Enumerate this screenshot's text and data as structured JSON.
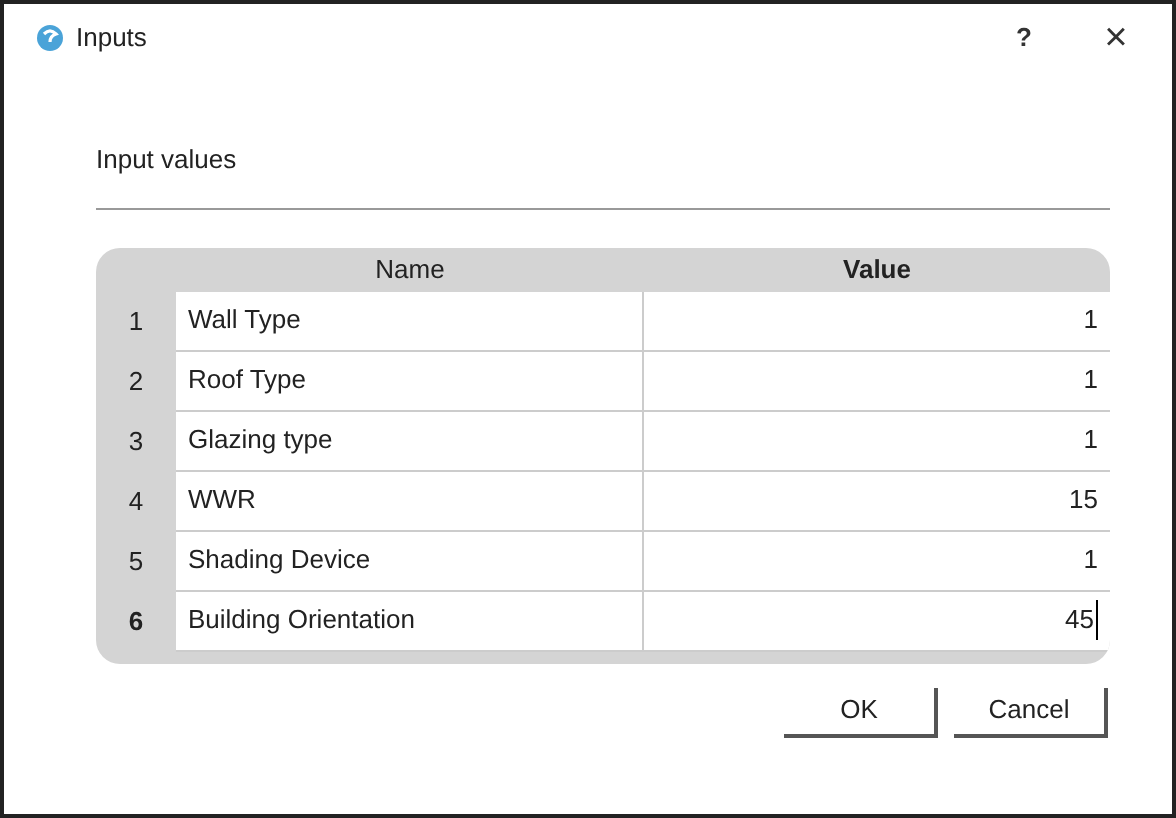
{
  "window": {
    "title": "Inputs",
    "help": "?",
    "close": "×"
  },
  "section_label": "Input values",
  "table": {
    "columns": [
      "Name",
      "Value"
    ],
    "rows": [
      {
        "number": "1",
        "name": "Wall Type",
        "value": "1",
        "current": false
      },
      {
        "number": "2",
        "name": "Roof Type",
        "value": "1",
        "current": false
      },
      {
        "number": "3",
        "name": "Glazing type",
        "value": "1",
        "current": false
      },
      {
        "number": "4",
        "name": "WWR",
        "value": "15",
        "current": false
      },
      {
        "number": "5",
        "name": "Shading Device",
        "value": "1",
        "current": false
      },
      {
        "number": "6",
        "name": "Building Orientation",
        "value": "45",
        "current": true
      }
    ]
  },
  "buttons": [
    "OK",
    "Cancel"
  ]
}
